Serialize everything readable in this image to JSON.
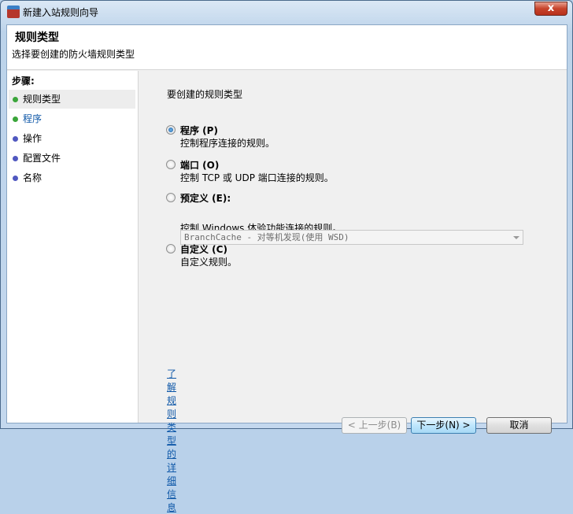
{
  "window": {
    "title": "新建入站规则向导",
    "close": "x"
  },
  "header": {
    "title": "规则类型",
    "subtitle": "选择要创建的防火墙规则类型"
  },
  "steps": {
    "label": "步骤:",
    "items": [
      {
        "label": "规则类型",
        "color": "#3aa53a"
      },
      {
        "label": "程序",
        "color": "#3aa53a"
      },
      {
        "label": "操作",
        "color": "#5058c0"
      },
      {
        "label": "配置文件",
        "color": "#5058c0"
      },
      {
        "label": "名称",
        "color": "#5058c0"
      }
    ]
  },
  "main": {
    "question": "要创建的规则类型",
    "options": [
      {
        "label": "程序 (P)",
        "desc": "控制程序连接的规则。",
        "selected": true
      },
      {
        "label": "端口 (O)",
        "desc": "控制 TCP 或 UDP 端口连接的规则。",
        "selected": false
      },
      {
        "label": "预定义 (E):",
        "desc": "控制 Windows 体验功能连接的规则。",
        "selected": false
      },
      {
        "label": "自定义 (C)",
        "desc": "自定义规则。",
        "selected": false
      }
    ],
    "predefined_value": "BranchCache - 对等机发现(使用 WSD)",
    "learn_more": "了解规则类型的详细信息"
  },
  "buttons": {
    "back": "< 上一步(B)",
    "next": "下一步(N) >",
    "cancel": "取消"
  }
}
